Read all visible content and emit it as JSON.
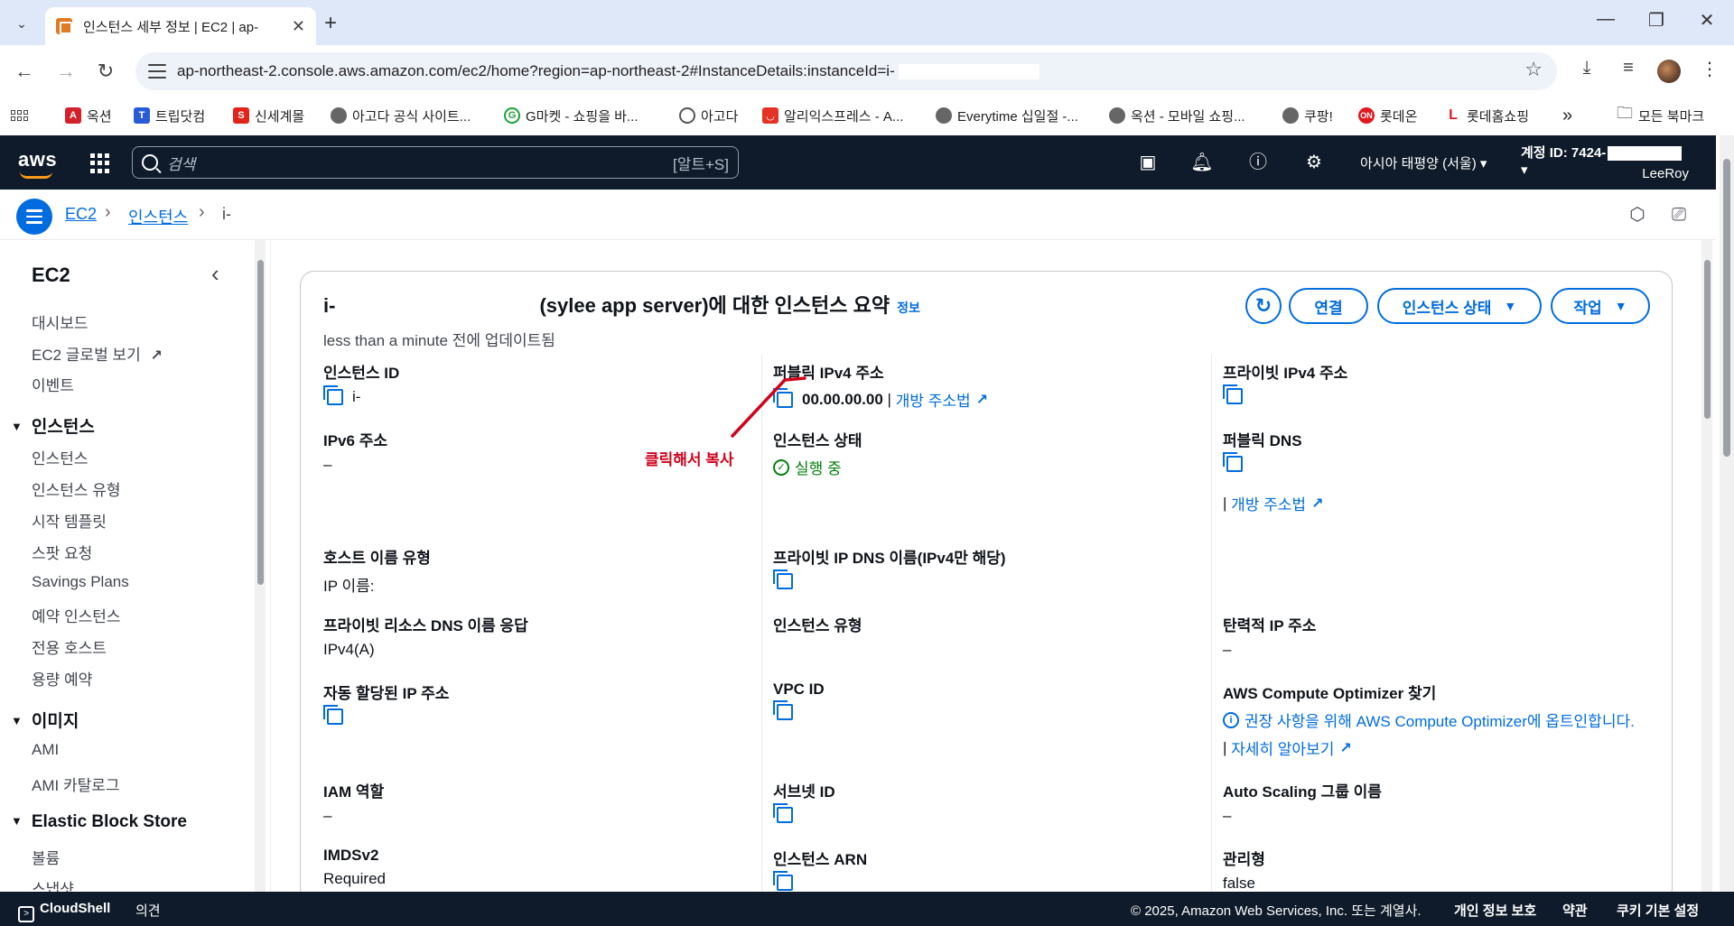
{
  "browser": {
    "tab_title": "인스턴스 세부 정보 | EC2 | ap-",
    "url": "ap-northeast-2.console.aws.amazon.com/ec2/home?region=ap-northeast-2#InstanceDetails:instanceId=i-",
    "bookmarks": [
      "옥션",
      "트립닷컴",
      "신세계몰",
      "아고다 공식 사이트...",
      "G마켓 - 쇼핑을 바...",
      "아고다",
      "알리익스프레스 - A...",
      "Everytime 십일절 -...",
      "옥션 - 모바일 쇼핑...",
      "쿠팡!",
      "롯데온",
      "롯데홈쇼핑"
    ],
    "bookmarks_more": "»",
    "all_bookmarks": "모든 북마크"
  },
  "aws_nav": {
    "logo": "aws",
    "search_placeholder": "검색",
    "search_shortcut": "[알트+S]",
    "region": "아시아 태평양 (서울)",
    "account_label": "계정 ID: 7424-",
    "user": "LeeRoy"
  },
  "breadcrumb": {
    "ec2": "EC2",
    "instances": "인스턴스",
    "current": "i-"
  },
  "sidenav": {
    "title": "EC2",
    "items_top": [
      "대시보드",
      "EC2 글로벌 보기",
      "이벤트"
    ],
    "sec_instances": "인스턴스",
    "items_instances": [
      "인스턴스",
      "인스턴스 유형",
      "시작 템플릿",
      "스팟 요청",
      "Savings Plans",
      "예약 인스턴스",
      "전용 호스트",
      "용량 예약"
    ],
    "sec_images": "이미지",
    "items_images": [
      "AMI",
      "AMI 카탈로그"
    ],
    "sec_ebs": "Elastic Block Store",
    "items_ebs": [
      "볼륨",
      "스냅샷"
    ]
  },
  "summary": {
    "title_prefix": "i-",
    "title_rest": "(sylee app server)에 대한 인스턴스 요약",
    "info": "정보",
    "updated": "less than a minute 전에 업데이트됨",
    "btn_connect": "연결",
    "btn_state": "인스턴스 상태",
    "btn_actions": "작업",
    "fields": {
      "instance_id_label": "인스턴스 ID",
      "instance_id_value": "i-",
      "public_ipv4_label": "퍼블릭 IPv4 주소",
      "public_ipv4_value": "00.00.00.00",
      "open_addr": "개방 주소법",
      "private_ipv4_label": "프라이빗 IPv4 주소",
      "ipv6_label": "IPv6 주소",
      "ipv6_value": "–",
      "state_label": "인스턴스 상태",
      "state_value": "실행 중",
      "public_dns_label": "퍼블릭 DNS",
      "public_dns_open": "개방 주소법",
      "hostname_type_label": "호스트 이름 유형",
      "hostname_type_value": "IP 이름:",
      "private_dns_label": "프라이빗 IP DNS 이름(IPv4만 해당)",
      "resource_dns_label": "프라이빗 리소스 DNS 이름 응답",
      "resource_dns_value": "IPv4(A)",
      "instance_type_label": "인스턴스 유형",
      "elastic_ip_label": "탄력적 IP 주소",
      "elastic_ip_value": "–",
      "auto_ip_label": "자동 할당된 IP 주소",
      "vpc_label": "VPC ID",
      "optimizer_label": "AWS Compute Optimizer 찾기",
      "optimizer_text": "권장 사항을 위해 AWS Compute Optimizer에 옵트인합니다.",
      "learn_more": "자세히 알아보기",
      "iam_label": "IAM 역할",
      "iam_value": "–",
      "subnet_label": "서브넷 ID",
      "asg_label": "Auto Scaling 그룹 이름",
      "asg_value": "–",
      "imds_label": "IMDSv2",
      "imds_value": "Required",
      "arn_label": "인스턴스 ARN",
      "managed_label": "관리형",
      "managed_value": "false"
    },
    "annotation": "클릭해서 복사"
  },
  "footer": {
    "cloudshell": "CloudShell",
    "feedback": "의견",
    "copyright": "© 2025, Amazon Web Services, Inc. 또는 계열사.",
    "privacy": "개인 정보 보호",
    "terms": "약관",
    "cookies": "쿠키 기본 설정"
  }
}
